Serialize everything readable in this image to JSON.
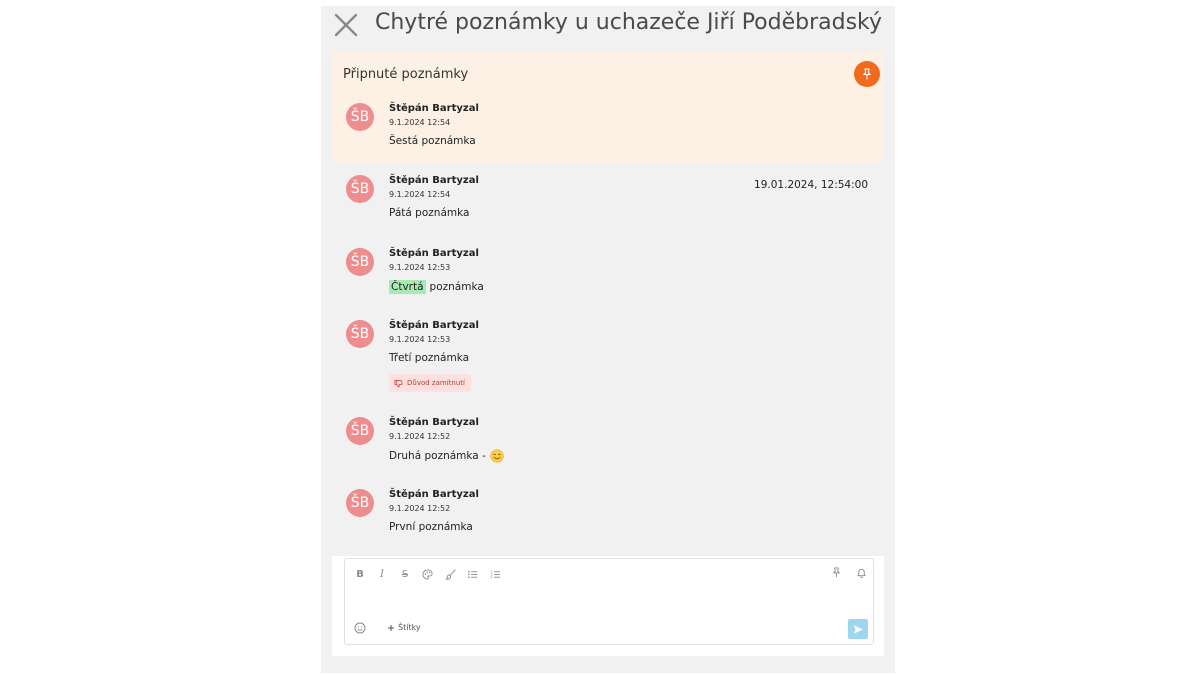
{
  "panel": {
    "title": "Chytré poznámky u uchazeče Jiří Poděbradský"
  },
  "pinned": {
    "header": "Připnuté poznámky",
    "note": {
      "avatar_initials": "ŠB",
      "author": "Štěpán Bartyzal",
      "date": "9.1.2024 12:54",
      "text": "Šestá poznámka"
    }
  },
  "notes": [
    {
      "avatar_initials": "ŠB",
      "author": "Štěpán Bartyzal",
      "date": "9.1.2024 12:54",
      "text": "Pátá poznámka",
      "timestamp": "19.01.2024, 12:54:00"
    },
    {
      "avatar_initials": "ŠB",
      "author": "Štěpán Bartyzal",
      "date": "9.1.2024 12:53",
      "highlight": "Čtvrtá",
      "text": "poznámka"
    },
    {
      "avatar_initials": "ŠB",
      "author": "Štěpán Bartyzal",
      "date": "9.1.2024 12:53",
      "text": "Třetí poznámka",
      "badge": "Důvod zamítnutí"
    },
    {
      "avatar_initials": "ŠB",
      "author": "Štěpán Bartyzal",
      "date": "9.1.2024 12:52",
      "text": "Druhá poznámka -",
      "emoji": "smiling-face"
    },
    {
      "avatar_initials": "ŠB",
      "author": "Štěpán Bartyzal",
      "date": "9.1.2024 12:52",
      "text": "První poznámka"
    }
  ],
  "editor": {
    "tags_label": "Štítky",
    "toolbar": [
      "bold-icon",
      "italic-icon",
      "strikethrough-icon",
      "palette-icon",
      "brush-icon",
      "bullet-list-icon",
      "numbered-list-icon"
    ]
  },
  "colors": {
    "accent": "#f26a1b",
    "avatar": "#ee8d8d",
    "pinned_bg": "#fdf1e6",
    "highlight": "#a7eab4",
    "send": "#9fd6ee"
  }
}
